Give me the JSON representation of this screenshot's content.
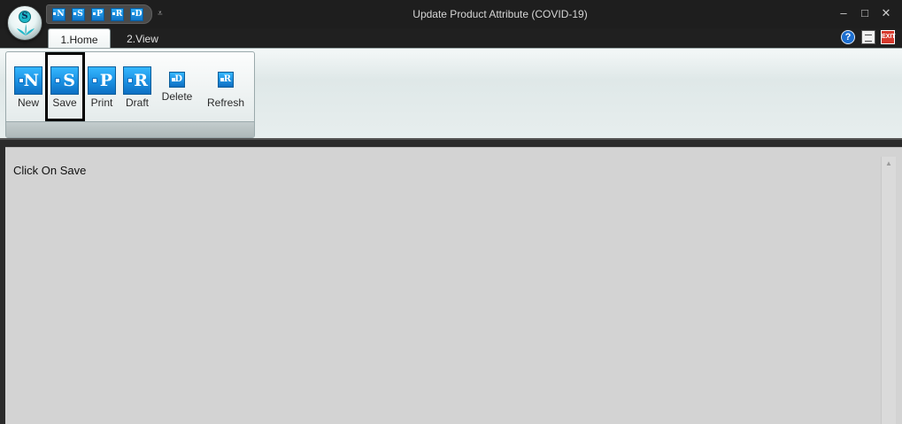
{
  "window": {
    "title": "Update Product Attribute (COVID-19)",
    "controls": {
      "minimize": "–",
      "maximize": "□",
      "close": "✕"
    }
  },
  "app_menu": {
    "logo_letter": "S"
  },
  "quick_access": {
    "buttons": [
      {
        "letter": "N",
        "icon": "new-icon"
      },
      {
        "letter": "S",
        "icon": "save-icon"
      },
      {
        "letter": "P",
        "icon": "print-icon"
      },
      {
        "letter": "R",
        "icon": "draft-icon"
      },
      {
        "letter": "D",
        "icon": "delete-icon"
      }
    ],
    "customize_glyph": "⩡"
  },
  "tabs": [
    {
      "label": "1.Home",
      "active": true
    },
    {
      "label": "2.View",
      "active": false
    }
  ],
  "help_icons": {
    "help": "?",
    "exit": "EXIT"
  },
  "ribbon": {
    "buttons": [
      {
        "label": "New",
        "letter": "N",
        "size": "large"
      },
      {
        "label": "Save",
        "letter": "S",
        "size": "large",
        "highlighted": true
      },
      {
        "label": "Print",
        "letter": "P",
        "size": "large"
      },
      {
        "label": "Draft",
        "letter": "R",
        "size": "large"
      },
      {
        "label": "Delete",
        "letter": "D",
        "size": "small"
      },
      {
        "label": "Refresh",
        "letter": "R",
        "size": "small"
      }
    ]
  },
  "content": {
    "instruction": "Click On Save",
    "scroll_up_glyph": "▲"
  },
  "colors": {
    "titlebar": "#1e1e1e",
    "ribbon_button_blue": "#1a8fe0",
    "content_bg": "#d3d3d3"
  }
}
